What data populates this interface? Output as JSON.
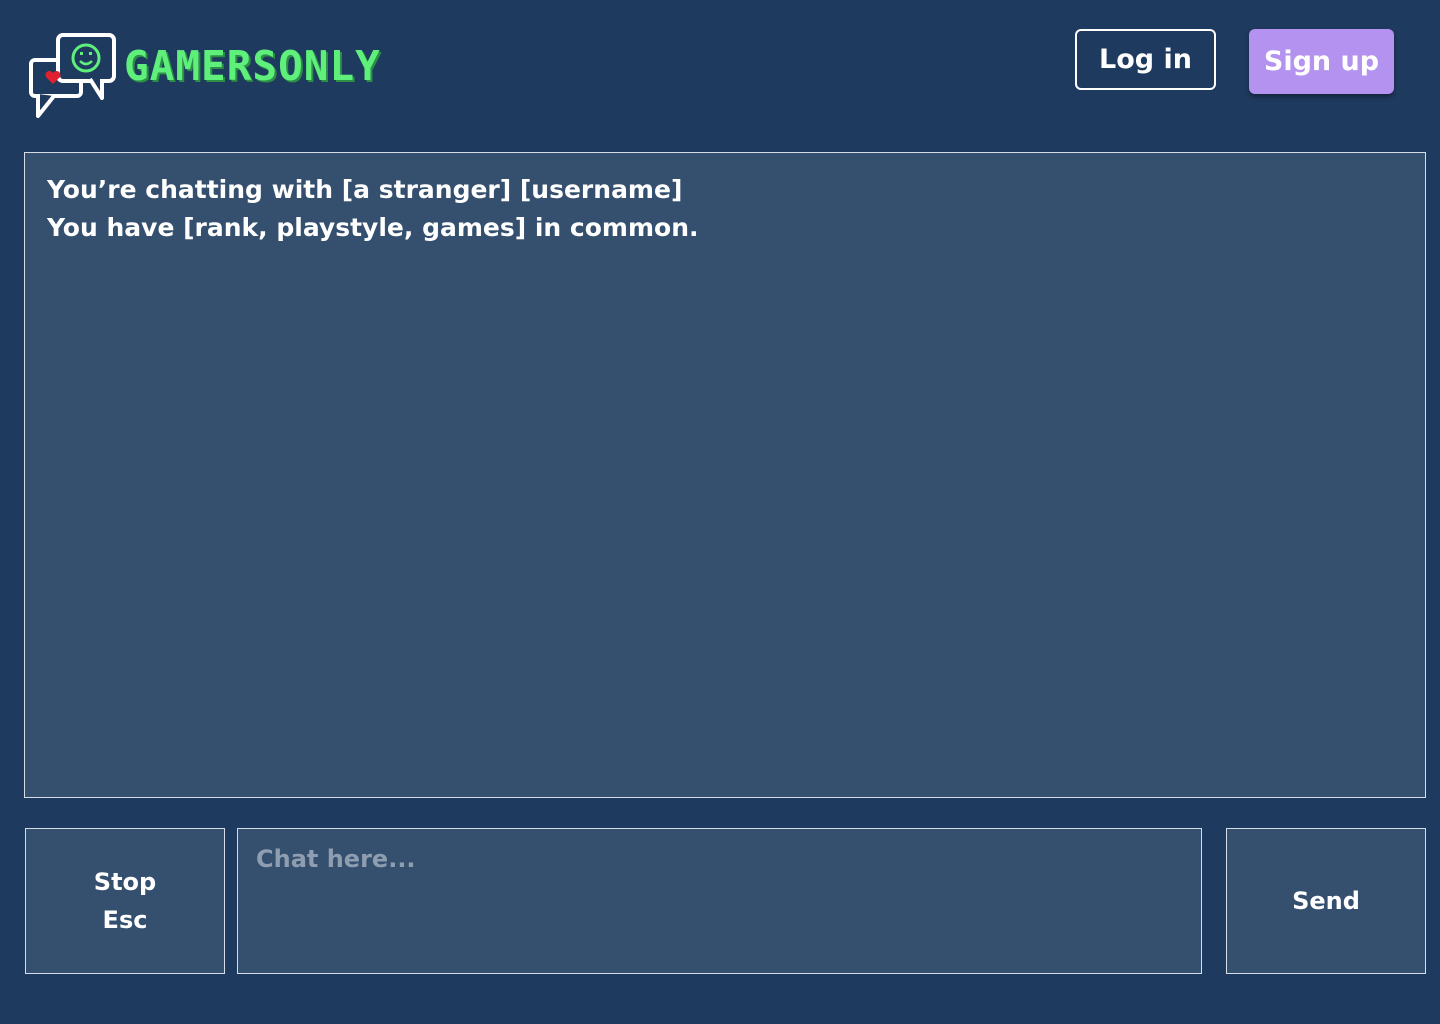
{
  "header": {
    "logo_text": "GAMERSONLY",
    "logo_icon": "chat-bubbles-icon",
    "login_label": "Log in",
    "signup_label": "Sign up"
  },
  "chat": {
    "lines": [
      "You’re chatting with [a stranger] [username]",
      "You have [rank, playstyle, games] in common."
    ]
  },
  "controls": {
    "stop_label": "Stop",
    "stop_shortcut": "Esc",
    "input_placeholder": "Chat here...",
    "input_value": "",
    "send_label": "Send"
  },
  "colors": {
    "background": "#1f3a5f",
    "panel": "#35506f",
    "accent_green": "#5ef07a",
    "signup_purple": "#b392f0",
    "heart_red": "#e0212f"
  }
}
